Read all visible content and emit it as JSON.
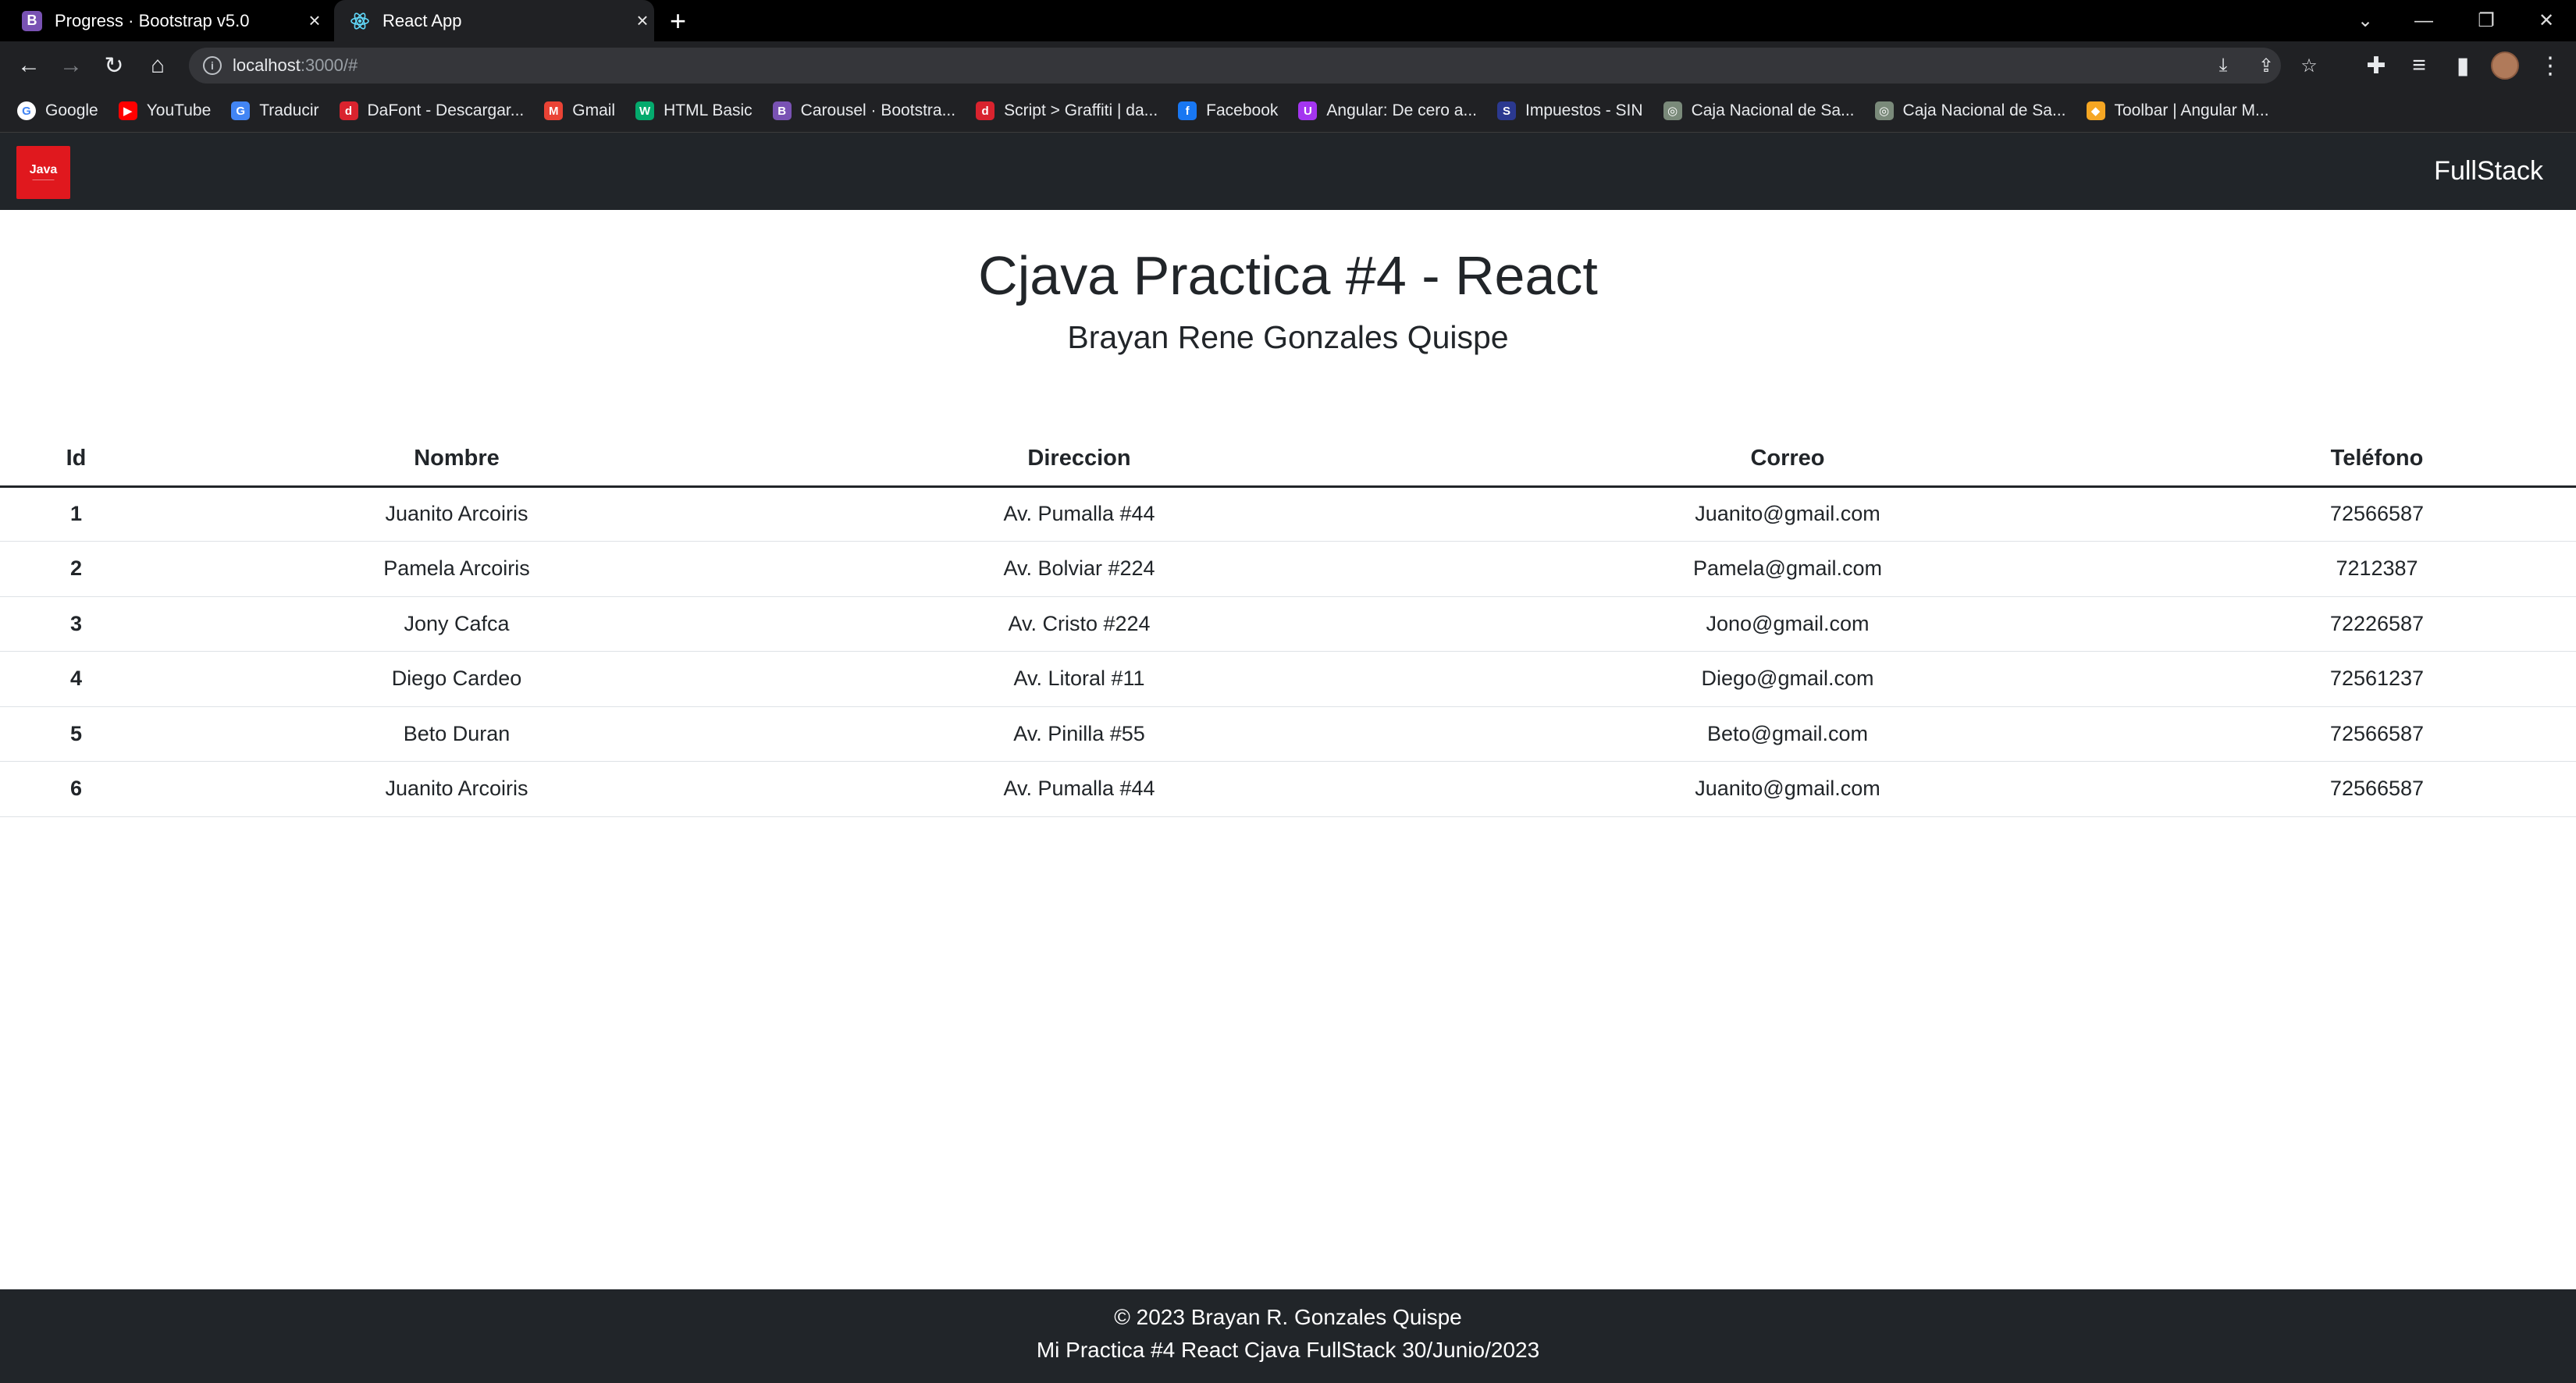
{
  "browser": {
    "tabs": [
      {
        "title": "Progress · Bootstrap v5.0",
        "favicon": "bootstrap-icon",
        "active": false
      },
      {
        "title": "React App",
        "favicon": "react-icon",
        "active": true
      }
    ],
    "url_host": "localhost",
    "url_path": ":3000/#",
    "bookmarks": [
      {
        "label": "Google",
        "icon": "google-icon",
        "color": "#ffffff"
      },
      {
        "label": "YouTube",
        "icon": "youtube-icon",
        "color": "#ff0000"
      },
      {
        "label": "Traducir",
        "icon": "translate-icon",
        "color": "#4285f4"
      },
      {
        "label": "DaFont - Descargar...",
        "icon": "dafont-icon",
        "color": "#d9232e"
      },
      {
        "label": "Gmail",
        "icon": "gmail-icon",
        "color": "#ea4335"
      },
      {
        "label": "HTML Basic",
        "icon": "w3-icon",
        "color": "#04aa6d"
      },
      {
        "label": "Carousel · Bootstra...",
        "icon": "bootstrap-icon",
        "color": "#7952b3"
      },
      {
        "label": "Script > Graffiti | da...",
        "icon": "dafont-icon",
        "color": "#d9232e"
      },
      {
        "label": "Facebook",
        "icon": "facebook-icon",
        "color": "#1877f2"
      },
      {
        "label": "Angular: De cero a...",
        "icon": "udemy-icon",
        "color": "#a435f0"
      },
      {
        "label": "Impuestos - SIN",
        "icon": "sin-icon",
        "color": "#2b3990"
      },
      {
        "label": "Caja Nacional de Sa...",
        "icon": "cns-icon",
        "color": "#7a8a7a"
      },
      {
        "label": "Caja Nacional de Sa...",
        "icon": "cns-icon",
        "color": "#7a8a7a"
      },
      {
        "label": "Toolbar | Angular M...",
        "icon": "shield-icon",
        "color": "#f5a623"
      }
    ]
  },
  "navbar": {
    "brand_logo_text": "Java",
    "brand_right": "FullStack"
  },
  "header": {
    "title": "Cjava Practica #4 - React",
    "subtitle": "Brayan Rene Gonzales Quispe"
  },
  "table": {
    "columns": [
      "Id",
      "Nombre",
      "Direccion",
      "Correo",
      "Teléfono"
    ],
    "rows": [
      [
        "1",
        "Juanito Arcoiris",
        "Av. Pumalla #44",
        "Juanito@gmail.com",
        "72566587"
      ],
      [
        "2",
        "Pamela Arcoiris",
        "Av. Bolviar #224",
        "Pamela@gmail.com",
        "7212387"
      ],
      [
        "3",
        "Jony Cafca",
        "Av. Cristo #224",
        "Jono@gmail.com",
        "72226587"
      ],
      [
        "4",
        "Diego Cardeo",
        "Av. Litoral #11",
        "Diego@gmail.com",
        "72561237"
      ],
      [
        "5",
        "Beto Duran",
        "Av. Pinilla #55",
        "Beto@gmail.com",
        "72566587"
      ],
      [
        "6",
        "Juanito Arcoiris",
        "Av. Pumalla #44",
        "Juanito@gmail.com",
        "72566587"
      ]
    ]
  },
  "footer": {
    "line1": "© 2023 Brayan R. Gonzales Quispe",
    "line2": "Mi Practica #4 React Cjava FullStack 30/Junio/2023"
  },
  "colors": {
    "navbar_bg": "#212529",
    "logo_red": "#e0181e",
    "browser_bg": "#202124"
  }
}
